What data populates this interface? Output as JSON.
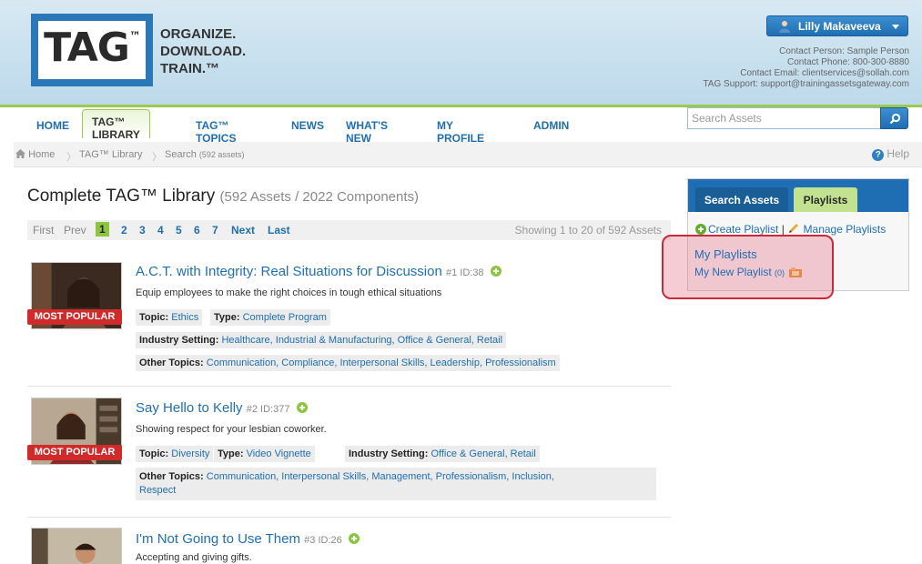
{
  "brand": {
    "logo_text": "TAG",
    "logo_tm": "™",
    "tagline": [
      "ORGANIZE.",
      "DOWNLOAD.",
      "TRAIN.™"
    ]
  },
  "user": {
    "name": "Lilly Makaveeva"
  },
  "contact": {
    "person": "Contact Person: Sample Person",
    "phone": "Contact Phone: 800-300-8880",
    "email": "Contact Email: clientservices@sollah.com",
    "support": "TAG Support: support@trainingassetsgateway.com"
  },
  "nav": {
    "items": [
      {
        "label": "HOME"
      },
      {
        "label": "TAG™ LIBRARY"
      },
      {
        "label": "TAG™ TOPICS"
      },
      {
        "label": "NEWS"
      },
      {
        "label": "WHAT'S NEW"
      },
      {
        "label": "MY PROFILE"
      },
      {
        "label": "ADMIN"
      }
    ],
    "active": "TAG™ LIBRARY"
  },
  "search": {
    "placeholder": "Search Assets"
  },
  "breadcrumb": {
    "home": "Home",
    "library": "TAG™ Library",
    "search": "Search",
    "count": "(592 assets)",
    "help": "Help"
  },
  "page": {
    "title": "Complete TAG™ Library",
    "subtitle": "(592 Assets / 2022 Components)"
  },
  "pager": {
    "first": "First",
    "prev": "Prev",
    "pages": [
      "1",
      "2",
      "3",
      "4",
      "5",
      "6",
      "7"
    ],
    "current": "1",
    "next": "Next",
    "last": "Last",
    "showing": "Showing 1 to 20 of 592 Assets"
  },
  "assets": [
    {
      "title": "A.C.T. with Integrity: Real Situations for Discussion",
      "meta": "#1 ID:38",
      "desc": "Equip employees to make the right choices in tough ethical situations",
      "badge": "MOST POPULAR",
      "topic_label": "Topic:",
      "topic": "Ethics",
      "type_label": "Type:",
      "type": "Complete Program",
      "industry_label": "Industry Setting:",
      "industry": "Healthcare, Industrial & Manufacturing, Office & General, Retail",
      "other_label": "Other Topics:",
      "other": "Communication, Compliance, Interpersonal Skills, Leadership, Professionalism"
    },
    {
      "title": "Say Hello to Kelly",
      "meta": "#2 ID:377",
      "desc": "Showing respect for your lesbian coworker.",
      "badge": "MOST POPULAR",
      "topic_label": "Topic:",
      "topic": "Diversity",
      "type_label": "Type:",
      "type": "Video Vignette",
      "industry_label": "Industry Setting:",
      "industry": "Office & General, Retail",
      "other_label": "Other Topics:",
      "other_line1": "Communication, Interpersonal Skills, Management, Professionalism, Inclusion,",
      "other_line2": "Respect"
    },
    {
      "title": "I'm Not Going to Use Them",
      "meta": "#3 ID:26",
      "desc": "Accepting and giving gifts."
    }
  ],
  "sidebar": {
    "tab_search": "Search Assets",
    "tab_playlists": "Playlists",
    "create": "Create Playlist",
    "divider": "|",
    "manage": "Manage Playlists",
    "my_playlists": "My Playlists",
    "my_new_playlist": "My New Playlist",
    "my_new_playlist_count": "(0)"
  },
  "colors": {
    "brand_blue": "#1f6eb3",
    "accent_green": "#8cc63f",
    "badge_red": "#d02a2a",
    "highlight": "#c82a3c"
  }
}
